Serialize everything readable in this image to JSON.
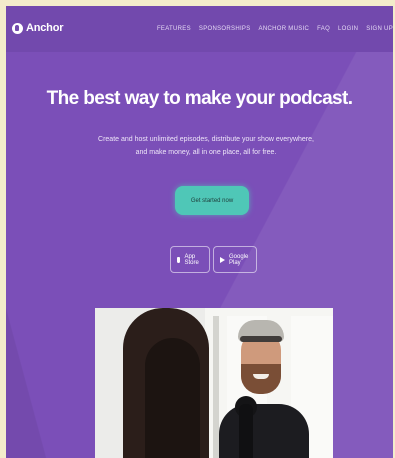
{
  "brand": {
    "name": "Anchor",
    "accent_color": "#7b4fb8",
    "cta_color": "#4fc7b7"
  },
  "nav": {
    "items": [
      "Features",
      "Sponsorships",
      "Anchor Music",
      "FAQ",
      "Login",
      "Sign up"
    ]
  },
  "hero": {
    "headline": "The best way to make your podcast.",
    "subtitle": "Create and host unlimited episodes, distribute your show everywhere, and make money, all in one place, all for free.",
    "cta_label": "Get started now"
  },
  "stores": {
    "apple_label": "App Store",
    "google_label": "Google Play"
  },
  "icons": {
    "logo": "anchor-logo-icon",
    "apple": "apple-icon",
    "google": "play-icon"
  }
}
